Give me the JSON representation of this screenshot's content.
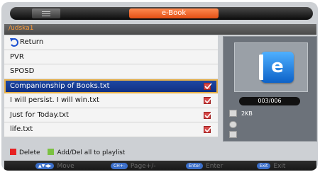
{
  "window": {
    "title": "e-Book"
  },
  "path": "/udska1",
  "files": [
    {
      "label": "Return",
      "type": "back"
    },
    {
      "label": "PVR",
      "type": "folder"
    },
    {
      "label": "SPOSD",
      "type": "folder"
    },
    {
      "label": "Companionship of Books.txt",
      "type": "file",
      "selected": true,
      "checked": true
    },
    {
      "label": "I will persist. I will win.txt",
      "type": "file",
      "checked": true
    },
    {
      "label": "Just for Today.txt",
      "type": "file",
      "checked": true
    },
    {
      "label": "life.txt",
      "type": "file",
      "checked": true
    }
  ],
  "preview": {
    "icon": "ebook-icon",
    "icon_letter": "e",
    "counter": "003/006",
    "file_size": "2KB"
  },
  "legend": {
    "delete_label": "Delete",
    "delete_color": "#e62222",
    "add_label": "Add/Del all to playlist",
    "add_color": "#7bc142"
  },
  "hints": [
    {
      "key": "▲▼◀▶",
      "label": "Move"
    },
    {
      "key": "CH+-",
      "label": "Page+/-"
    },
    {
      "key": "Enter",
      "label": "Enter"
    },
    {
      "key": "Exit",
      "label": "Exit"
    }
  ],
  "colors": {
    "accent_orange": "#e86a2c",
    "selected_row": "#1f4aa6",
    "check_red": "#d64a4a"
  }
}
